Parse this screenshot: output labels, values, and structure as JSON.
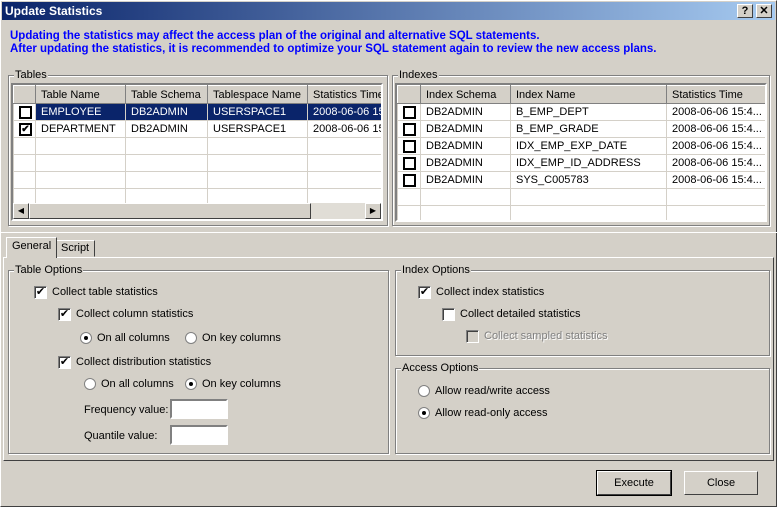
{
  "window": {
    "title": "Update Statistics",
    "help": "?",
    "close": "✕"
  },
  "info": {
    "line1": "Updating the statistics may affect the access plan of the original and alternative SQL statements.",
    "line2": "After updating the statistics, it is recommended to optimize your SQL statement again to review the new access plans."
  },
  "tables": {
    "label": "Tables",
    "columns": [
      "Table Name",
      "Table Schema",
      "Tablespace Name",
      "Statistics Time"
    ],
    "rows": [
      {
        "checked": false,
        "selected": true,
        "cells": [
          "EMPLOYEE",
          "DB2ADMIN",
          "USERSPACE1",
          "2008-06-06 15"
        ]
      },
      {
        "checked": true,
        "selected": false,
        "cells": [
          "DEPARTMENT",
          "DB2ADMIN",
          "USERSPACE1",
          "2008-06-06 15"
        ]
      }
    ]
  },
  "indexes": {
    "label": "Indexes",
    "columns": [
      "Index Schema",
      "Index Name",
      "Statistics Time"
    ],
    "rows": [
      {
        "checked": false,
        "cells": [
          "DB2ADMIN",
          "B_EMP_DEPT",
          "2008-06-06 15:4..."
        ]
      },
      {
        "checked": false,
        "cells": [
          "DB2ADMIN",
          "B_EMP_GRADE",
          "2008-06-06 15:4..."
        ]
      },
      {
        "checked": false,
        "cells": [
          "DB2ADMIN",
          "IDX_EMP_EXP_DATE",
          "2008-06-06 15:4..."
        ]
      },
      {
        "checked": false,
        "cells": [
          "DB2ADMIN",
          "IDX_EMP_ID_ADDRESS",
          "2008-06-06 15:4..."
        ]
      },
      {
        "checked": false,
        "cells": [
          "DB2ADMIN",
          "SYS_C005783",
          "2008-06-06 15:4..."
        ]
      }
    ]
  },
  "tabs": [
    "General",
    "Script"
  ],
  "table_options": {
    "label": "Table Options",
    "collect_table": "Collect table statistics",
    "collect_column": "Collect column statistics",
    "col_all": "On all columns",
    "col_key": "On key columns",
    "collect_dist": "Collect distribution statistics",
    "dist_all": "On all columns",
    "dist_key": "On key columns",
    "frequency_label": "Frequency value:",
    "frequency_value": "",
    "quantile_label": "Quantile value:",
    "quantile_value": ""
  },
  "index_options": {
    "label": "Index Options",
    "collect_index": "Collect index statistics",
    "collect_detailed": "Collect detailed statistics",
    "collect_sampled": "Collect sampled statistics"
  },
  "access_options": {
    "label": "Access Options",
    "read_write": "Allow read/write access",
    "read_only": "Allow read-only access"
  },
  "buttons": {
    "execute": "Execute",
    "close": "Close"
  }
}
